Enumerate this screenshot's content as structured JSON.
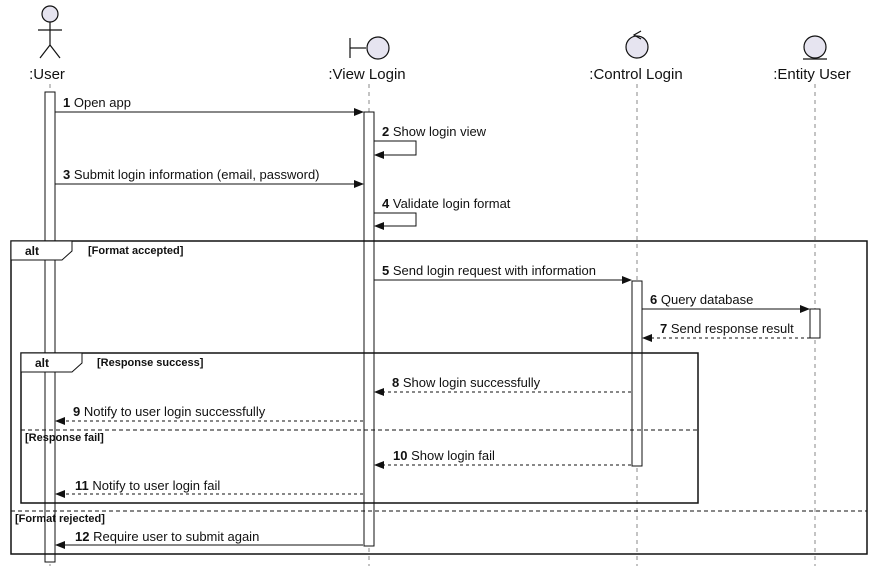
{
  "participants": [
    {
      "name": ":User",
      "kind": "actor"
    },
    {
      "name": ":View Login",
      "kind": "boundary"
    },
    {
      "name": ":Control Login",
      "kind": "control"
    },
    {
      "name": ":Entity User",
      "kind": "entity"
    }
  ],
  "messages": [
    {
      "num": "1",
      "text": "Open app",
      "from": ":User",
      "to": ":View Login",
      "style": "sync"
    },
    {
      "num": "2",
      "text": "Show login view",
      "from": ":View Login",
      "to": ":View Login",
      "style": "self"
    },
    {
      "num": "3",
      "text": "Submit login information (email, password)",
      "from": ":User",
      "to": ":View Login",
      "style": "sync"
    },
    {
      "num": "4",
      "text": "Validate login format",
      "from": ":View Login",
      "to": ":View Login",
      "style": "self"
    },
    {
      "num": "5",
      "text": "Send login request with information",
      "from": ":View Login",
      "to": ":Control Login",
      "style": "sync"
    },
    {
      "num": "6",
      "text": "Query database",
      "from": ":Control Login",
      "to": ":Entity User",
      "style": "sync"
    },
    {
      "num": "7",
      "text": "Send response result",
      "from": ":Entity User",
      "to": ":Control Login",
      "style": "return"
    },
    {
      "num": "8",
      "text": "Show login successfully",
      "from": ":Control Login",
      "to": ":View Login",
      "style": "return"
    },
    {
      "num": "9",
      "text": "Notify to user login successfully",
      "from": ":View Login",
      "to": ":User",
      "style": "return"
    },
    {
      "num": "10",
      "text": "Show login fail",
      "from": ":Control Login",
      "to": ":View Login",
      "style": "return"
    },
    {
      "num": "11",
      "text": "Notify to user login fail",
      "from": ":View Login",
      "to": ":User",
      "style": "return"
    },
    {
      "num": "12",
      "text": "Require user to submit again",
      "from": ":View Login",
      "to": ":User",
      "style": "return"
    }
  ],
  "fragments": [
    {
      "operator": "alt",
      "guards": [
        "[Format accepted]",
        "[Format rejected]"
      ]
    },
    {
      "operator": "alt",
      "guards": [
        "[Response success]",
        "[Response fail]"
      ]
    }
  ],
  "colors": {
    "lifeline": "#888888",
    "line": "#111111",
    "participant_fill": "#e6e4f0"
  }
}
